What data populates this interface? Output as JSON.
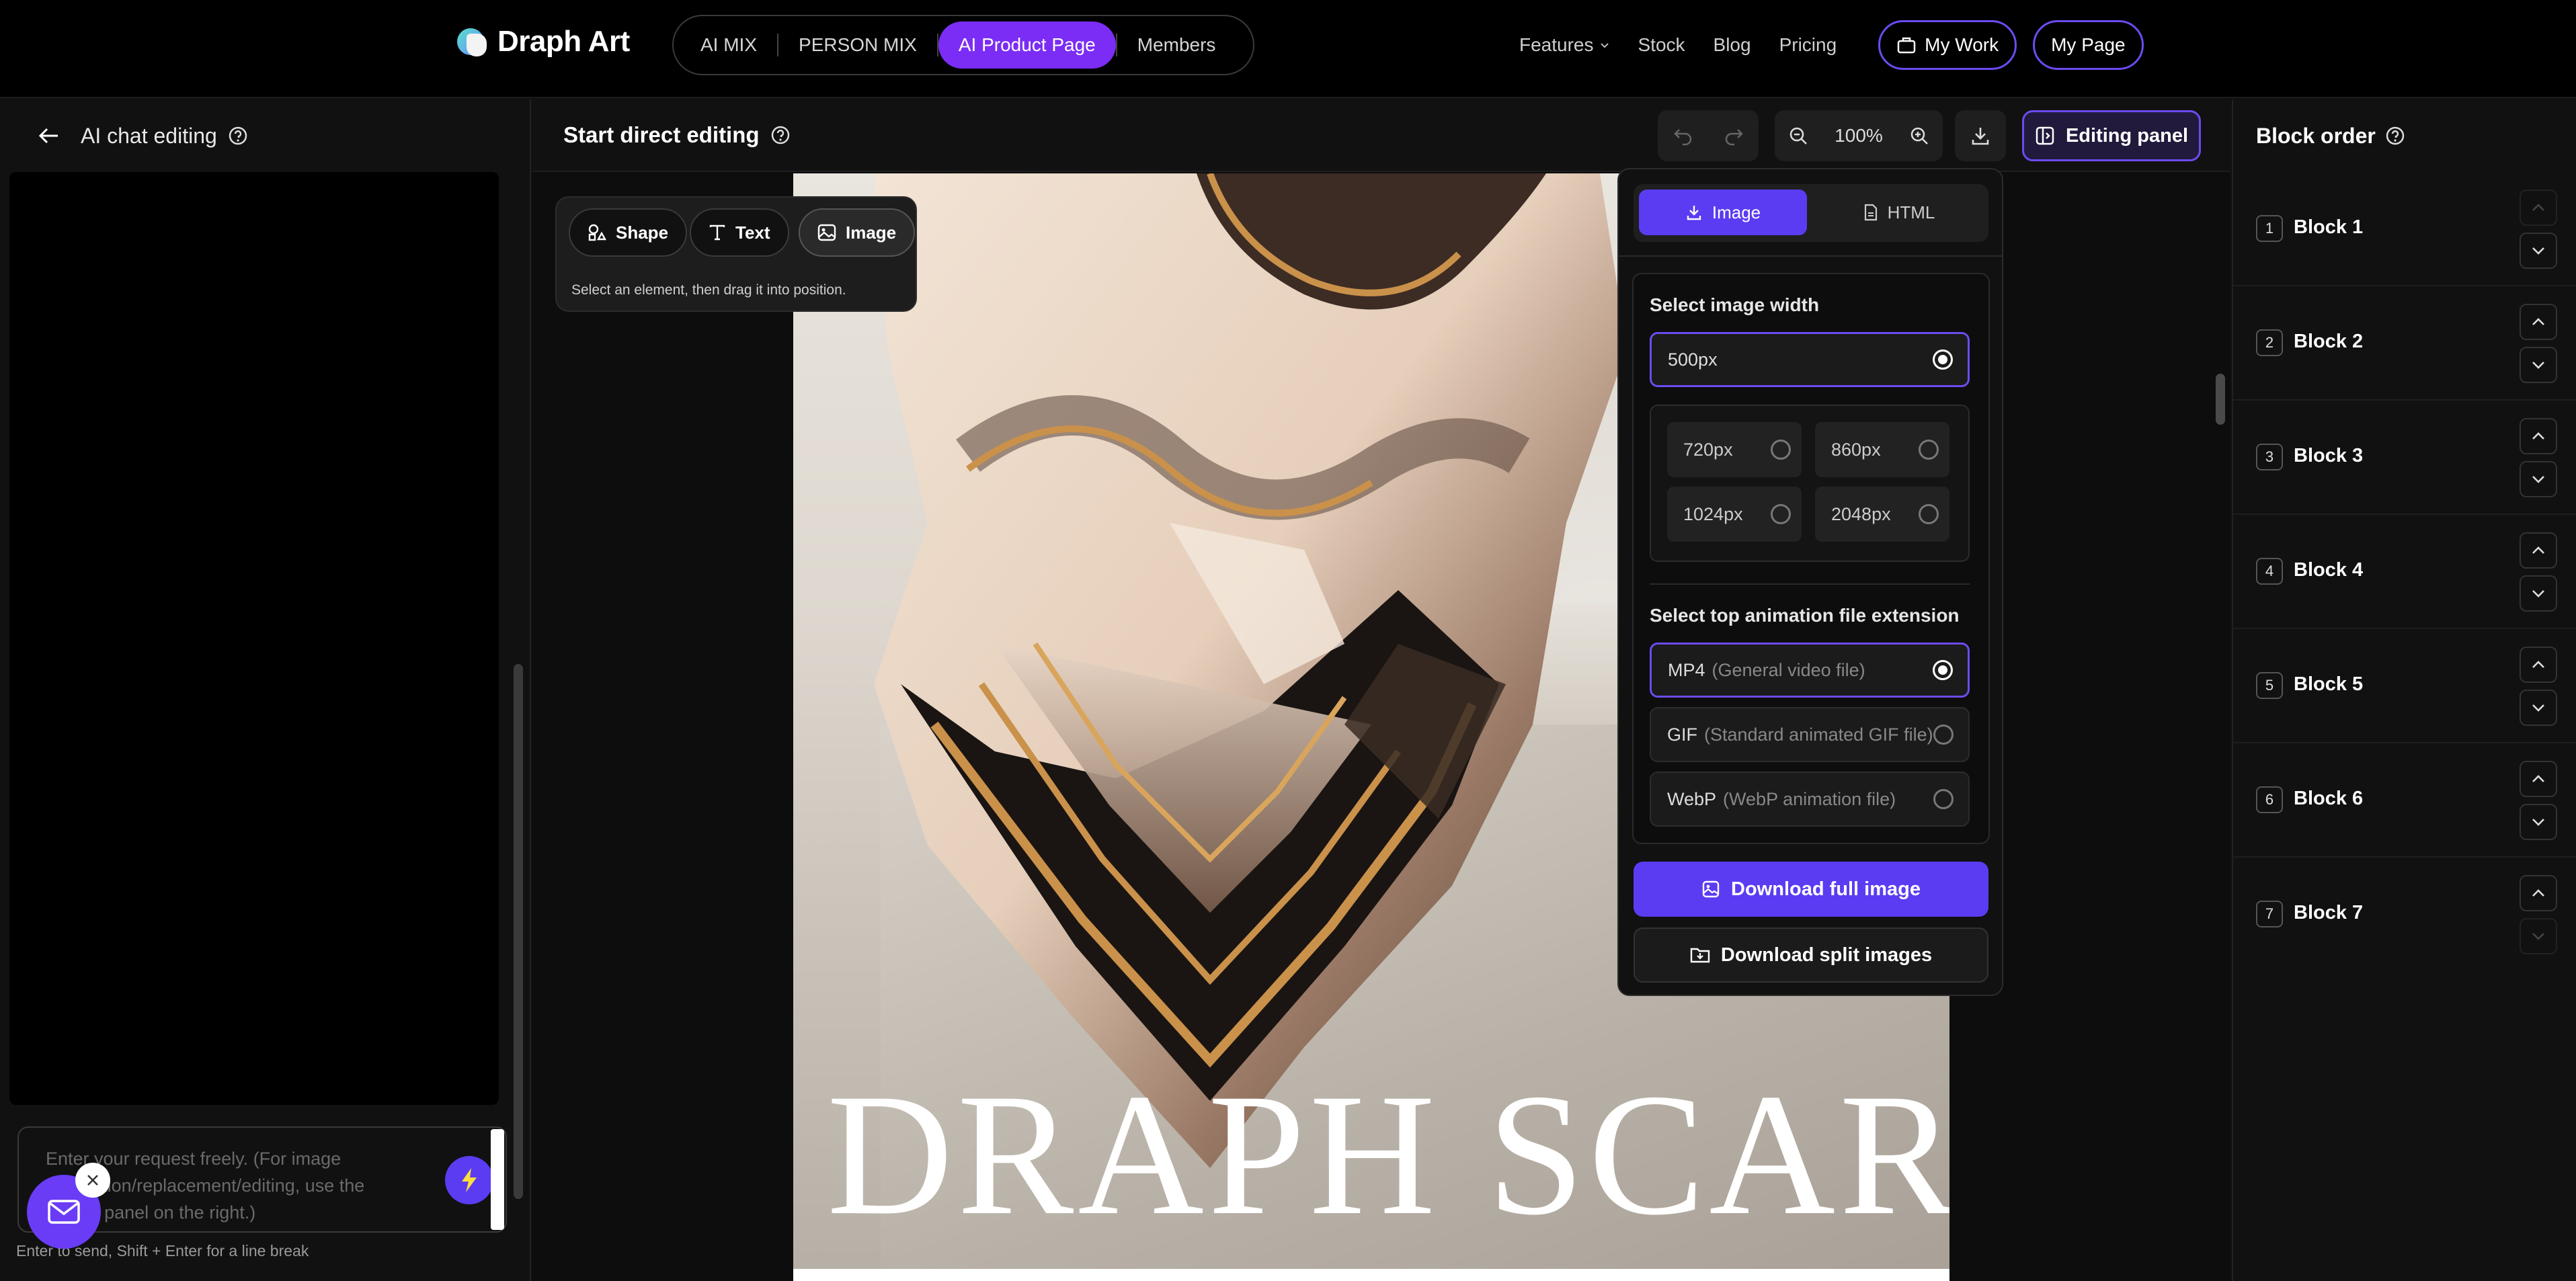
{
  "brand": {
    "name": "Draph Art"
  },
  "top_tabs": [
    {
      "label": "AI MIX",
      "active": false
    },
    {
      "label": "PERSON MIX",
      "active": false
    },
    {
      "label": "AI Product Page",
      "active": true
    },
    {
      "label": "Members",
      "active": false
    }
  ],
  "right_nav": {
    "features": "Features",
    "stock": "Stock",
    "blog": "Blog",
    "pricing": "Pricing",
    "my_work": "My Work",
    "my_page": "My Page"
  },
  "left_panel": {
    "title": "AI chat editing",
    "input_placeholder": "Enter your request freely. (For image generation/replacement/editing, use the editing panel on the right.)",
    "hint": "Enter to send, Shift + Enter for a line break"
  },
  "center": {
    "title": "Start direct editing",
    "zoom": "100%",
    "editing_panel_label": "Editing panel",
    "product_title": "DRAPH SCARF"
  },
  "palette": {
    "tools": [
      "Shape",
      "Text",
      "Image"
    ],
    "active_tool": "Image",
    "hint": "Select an element, then drag it into position."
  },
  "download_popup": {
    "tabs": [
      {
        "label": "Image",
        "active": true
      },
      {
        "label": "HTML",
        "active": false
      }
    ],
    "width_title": "Select image width",
    "width_selected": "500px",
    "width_options": [
      "720px",
      "860px",
      "1024px",
      "2048px"
    ],
    "ext_title": "Select top animation file extension",
    "ext_options": [
      {
        "name": "MP4",
        "desc": "(General video file)",
        "selected": true
      },
      {
        "name": "GIF",
        "desc": "(Standard animated GIF file)",
        "selected": false
      },
      {
        "name": "WebP",
        "desc": "(WebP animation file)",
        "selected": false
      }
    ],
    "download_full": "Download full image",
    "download_split": "Download split images"
  },
  "right_panel": {
    "title": "Block order",
    "blocks": [
      {
        "num": "1",
        "label": "Block 1"
      },
      {
        "num": "2",
        "label": "Block 2"
      },
      {
        "num": "3",
        "label": "Block 3"
      },
      {
        "num": "4",
        "label": "Block 4"
      },
      {
        "num": "5",
        "label": "Block 5"
      },
      {
        "num": "6",
        "label": "Block 6"
      },
      {
        "num": "7",
        "label": "Block 7"
      }
    ]
  },
  "colors": {
    "accent": "#5b3cf2",
    "tab_active": "#7b2cf5",
    "background": "#111111"
  }
}
